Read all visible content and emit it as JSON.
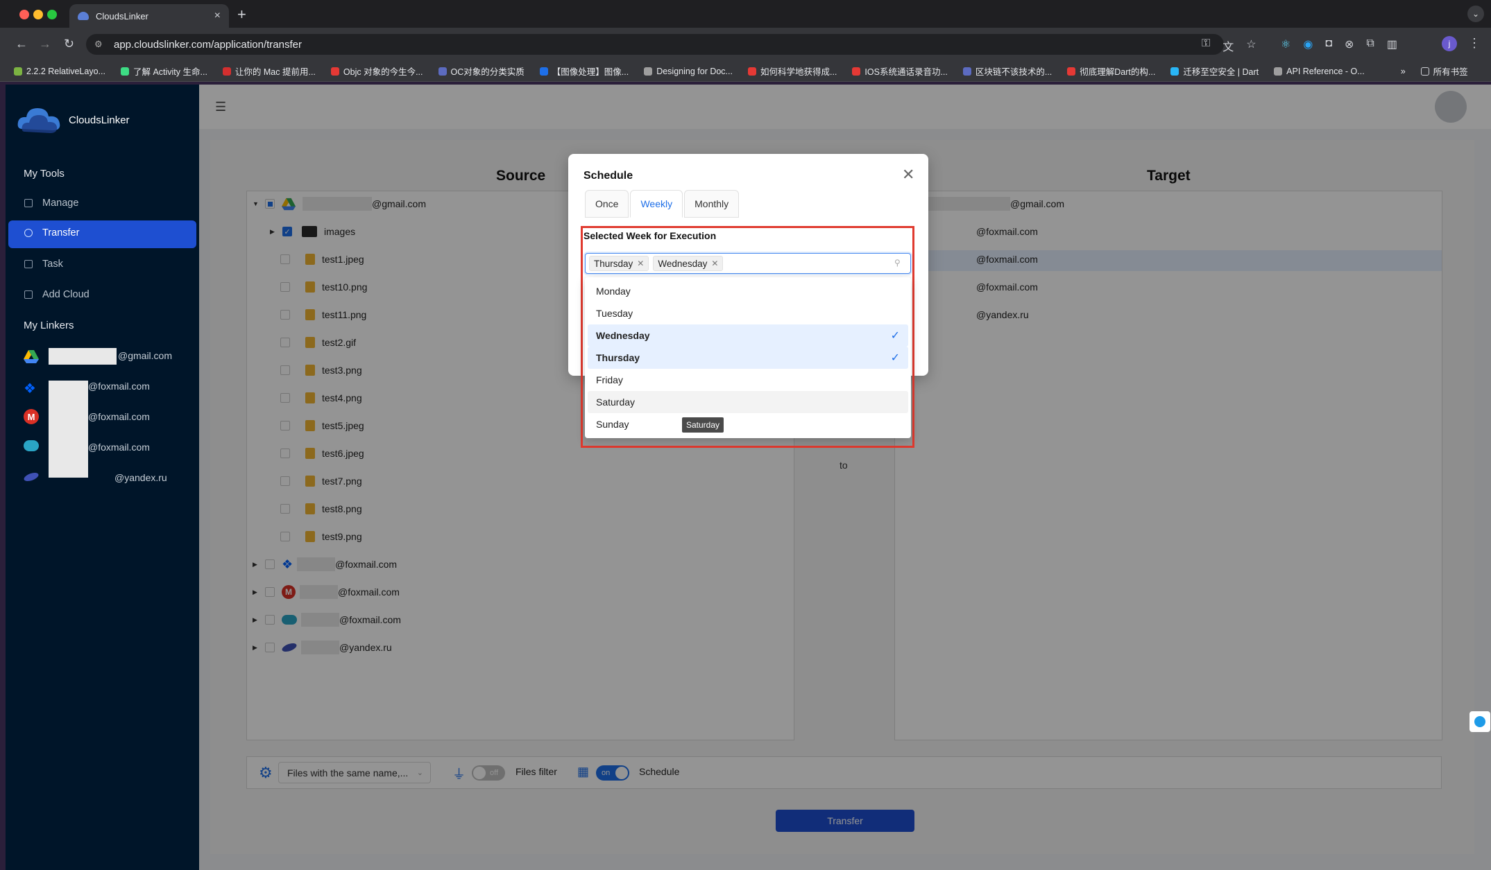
{
  "browser": {
    "tab_title": "CloudsLinker",
    "url": "app.cloudslinker.com/application/transfer",
    "profile_initial": "j",
    "bookmarks": [
      "2.2.2 RelativeLayo...",
      "了解 Activity 生命...",
      "让你的 Mac 提前用...",
      "Objc 对象的今生今...",
      "OC对象的分类实质",
      "【图像处理】图像...",
      "Designing for Doc...",
      "如何科学地获得成...",
      "IOS系统通话录音功...",
      "区块链不该技术的...",
      "彻底理解Dart的构...",
      "迁移至空安全 | Dart",
      "API Reference - O..."
    ],
    "bookmarks_more": "»",
    "all_bookmarks": "所有书签"
  },
  "app": {
    "name": "CloudsLinker",
    "sidebar": {
      "my_tools": "My Tools",
      "items": [
        "Manage",
        "Transfer",
        "Task",
        "Add Cloud"
      ],
      "my_linkers": "My Linkers",
      "linkers": [
        "@gmail.com",
        "@foxmail.com",
        "@foxmail.com",
        "@foxmail.com",
        "@yandex.ru"
      ],
      "linker_icon_colors": [
        "#34a853",
        "#0061fe",
        "#d93025",
        "#2aa4c4",
        "#3f51b5"
      ]
    }
  },
  "source": {
    "title": "Source",
    "root": "@gmail.com",
    "folder": "images",
    "files": [
      "test1.jpeg",
      "test10.png",
      "test11.png",
      "test2.gif",
      "test3.png",
      "test4.png",
      "test5.jpeg",
      "test6.jpeg",
      "test7.png",
      "test8.png",
      "test9.png"
    ],
    "other_accounts": [
      "@foxmail.com",
      "@foxmail.com",
      "@foxmail.com",
      "@yandex.ru"
    ]
  },
  "target": {
    "title": "Target",
    "accounts": [
      "@gmail.com",
      "@foxmail.com",
      "@foxmail.com",
      "@foxmail.com",
      "@yandex.ru"
    ]
  },
  "middle": {
    "to_label": "to"
  },
  "bottom": {
    "conflict_select": "Files with the same name,...",
    "filter_switch": "off",
    "filter_label": "Files filter",
    "schedule_switch": "on",
    "schedule_label": "Schedule",
    "transfer_button": "Transfer"
  },
  "modal": {
    "title": "Schedule",
    "tabs": [
      "Once",
      "Weekly",
      "Monthly"
    ],
    "active_tab": "Weekly",
    "field_label": "Selected Week for Execution",
    "selected_tags": [
      "Thursday",
      "Wednesday"
    ],
    "options": [
      "Monday",
      "Tuesday",
      "Wednesday",
      "Thursday",
      "Friday",
      "Saturday",
      "Sunday"
    ],
    "tooltip": "Saturday"
  }
}
